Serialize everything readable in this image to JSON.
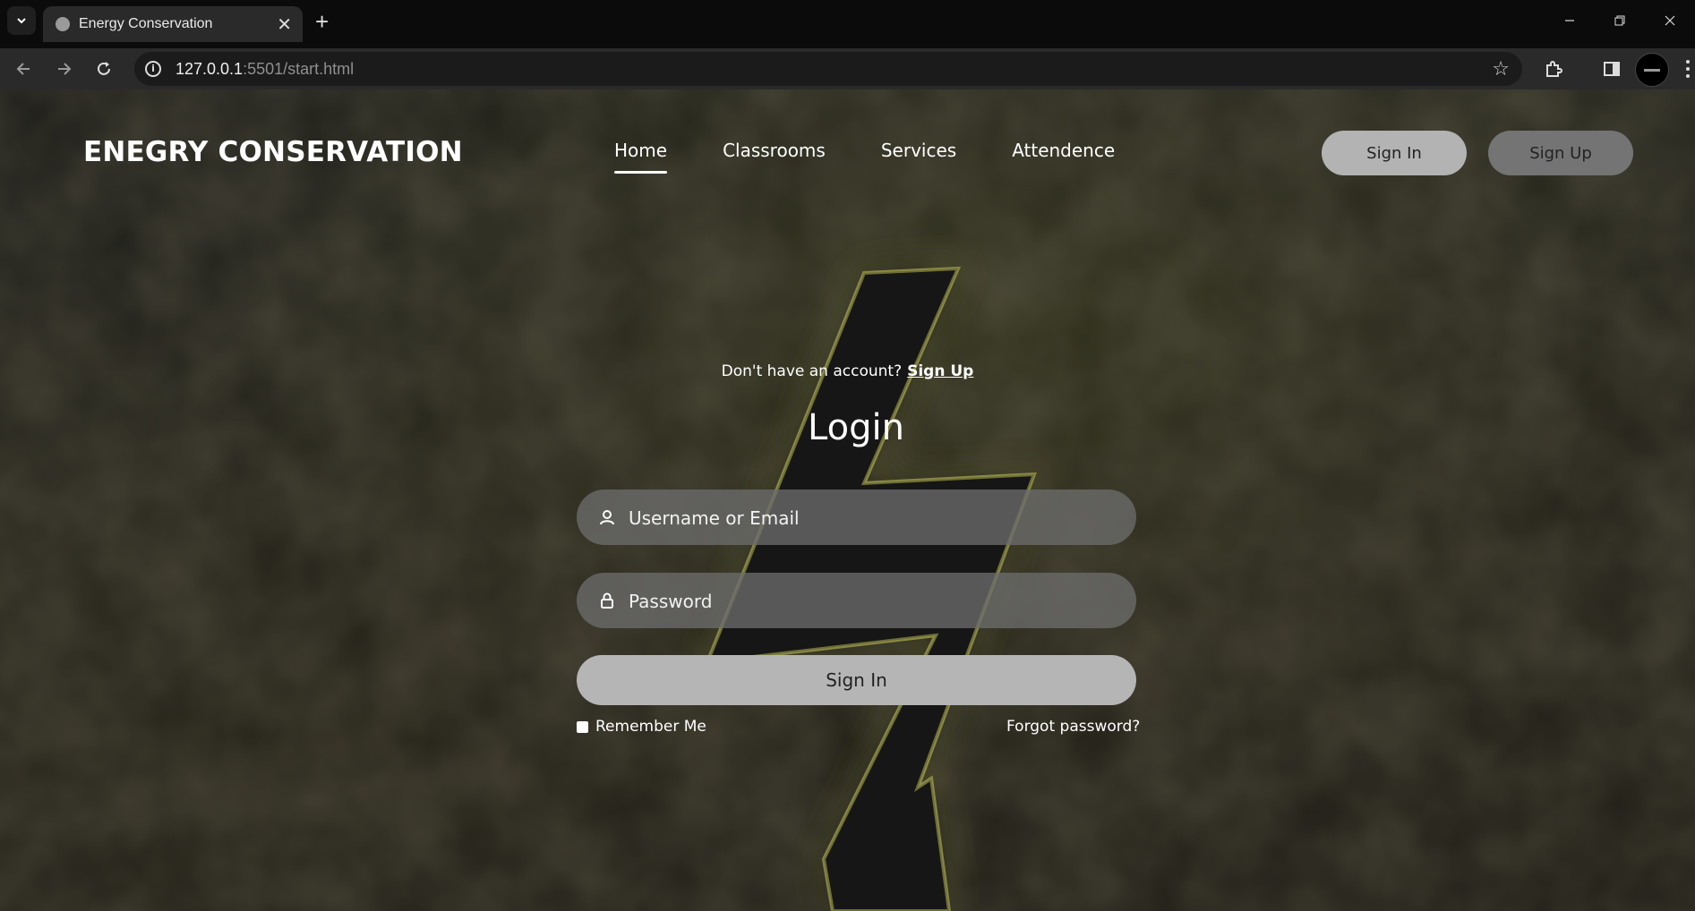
{
  "browser": {
    "tab_title": "Energy Conservation",
    "tab_close": "✕",
    "new_tab": "+",
    "url_host": "127.0.0.1",
    "url_rest": ":5501/start.html"
  },
  "header": {
    "brand": "ENEGRY CONSERVATION",
    "nav": [
      "Home",
      "Classrooms",
      "Services",
      "Attendence"
    ],
    "active_nav": "Home",
    "signin_label": "Sign In",
    "signup_label": "Sign Up"
  },
  "login": {
    "prompt": "Don't have an account?",
    "signup_link": "Sign Up",
    "title": "Login",
    "username_placeholder": "Username or Email",
    "password_placeholder": "Password",
    "submit_label": "Sign In",
    "remember_label": "Remember Me",
    "forgot_label": "Forgot password?"
  },
  "colors": {
    "page_bg": "#1c1c18",
    "bolt_glow": "#c8c84a",
    "field_bg": "#6c6c6c",
    "button_light": "#b5b5b5",
    "button_dark": "#747474"
  },
  "icons": [
    "dropdown-icon",
    "globe-icon",
    "close-icon",
    "plus-icon",
    "back-icon",
    "forward-icon",
    "reload-icon",
    "info-icon",
    "star-icon",
    "extensions-icon",
    "sidebar-icon",
    "user-icon",
    "lock-icon"
  ]
}
